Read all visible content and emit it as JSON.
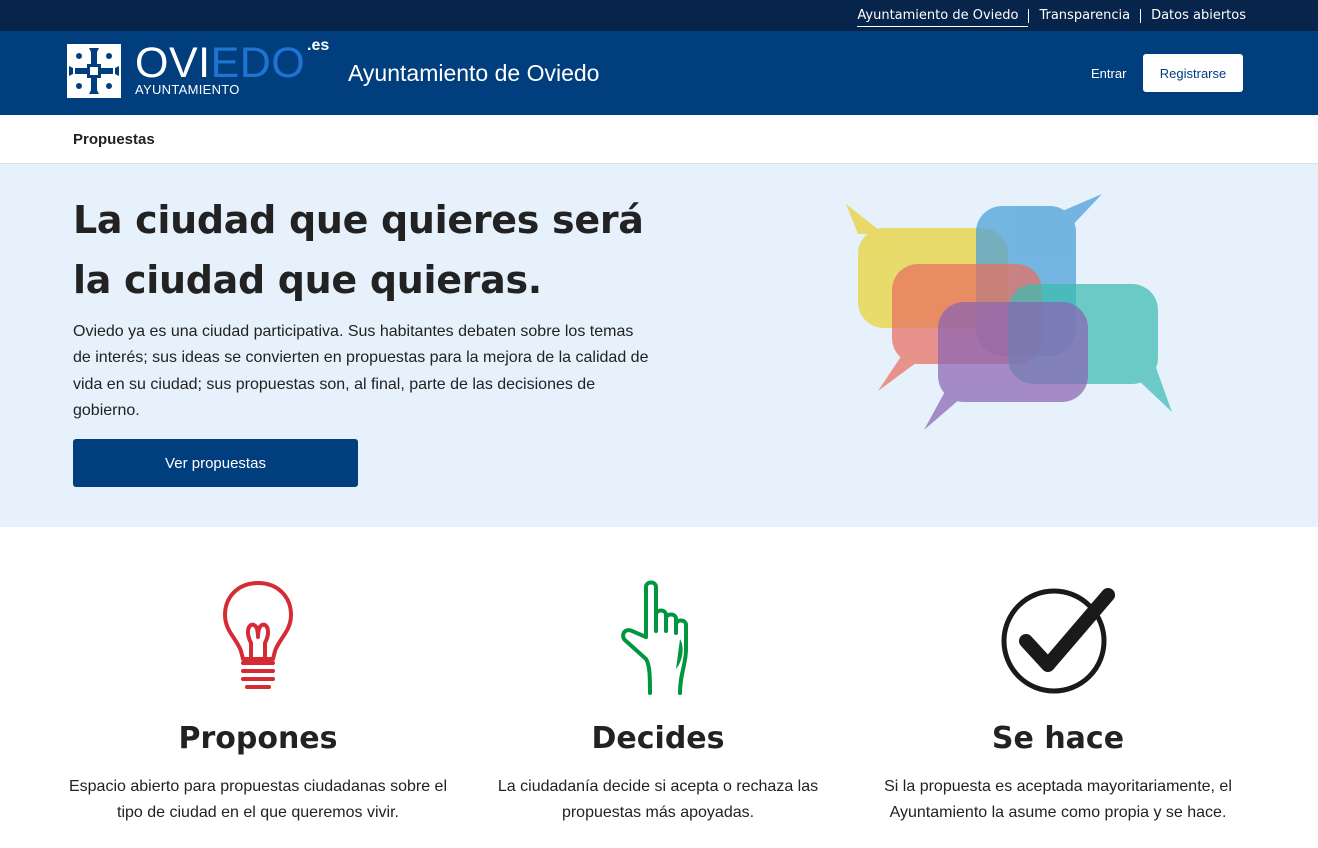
{
  "topbar": {
    "links": [
      {
        "label": "Ayuntamiento de Oviedo",
        "active": true
      },
      {
        "label": "Transparencia",
        "active": false
      },
      {
        "label": "Datos abiertos",
        "active": false
      }
    ]
  },
  "header": {
    "logo": {
      "word_part1": "OVI",
      "word_part2": "EDO",
      "suffix": ".es",
      "subtitle": "AYUNTAMIENTO"
    },
    "site_title": "Ayuntamiento de Oviedo",
    "login_label": "Entrar",
    "register_label": "Registrarse"
  },
  "subnav": {
    "item": "Propuestas"
  },
  "hero": {
    "title": "La ciudad que quieres será la ciudad que quieras.",
    "text": "Oviedo ya es una ciudad participativa. Sus habitantes debaten sobre los temas de interés; sus ideas se convierten en propuestas para la mejora de la calidad de vida en su ciudad; sus propuestas son, al final, parte de las decisiones de gobierno.",
    "cta_label": "Ver propuestas"
  },
  "features": [
    {
      "icon": "lightbulb-icon",
      "color": "#d52b35",
      "title": "Propones",
      "text": "Espacio abierto para propuestas ciudadanas sobre el tipo de ciudad en el que queremos vivir."
    },
    {
      "icon": "pointing-hand-icon",
      "color": "#00963f",
      "title": "Decides",
      "text": "La ciudadanía decide si acepta o rechaza las propuestas más apoyadas."
    },
    {
      "icon": "checkmark-circle-icon",
      "color": "#1a1a1a",
      "title": "Se hace",
      "text": "Si la propuesta es aceptada mayoritariamente, el Ayuntamiento la asume como propia y se hace."
    }
  ],
  "colors": {
    "topbar": "#07244b",
    "header": "#003e7e",
    "hero_bg": "#e6f1fc",
    "accent_blue": "#1f74d1"
  }
}
